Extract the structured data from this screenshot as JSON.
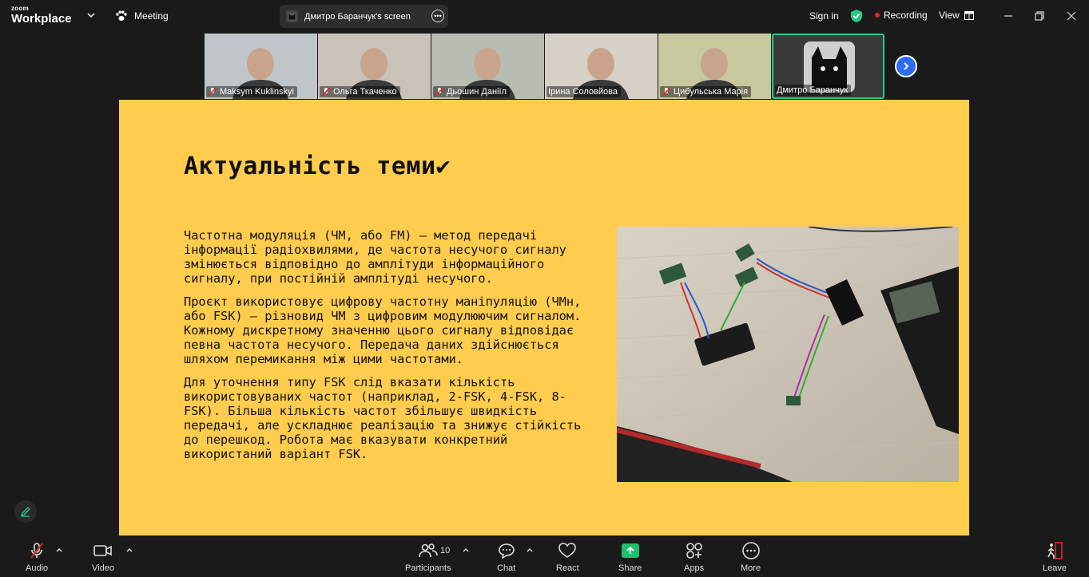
{
  "app": {
    "logo_small": "zoom",
    "logo_big": "Workplace",
    "meeting_label": "Meeting"
  },
  "screen_share": {
    "label": "Дмитро Баранчук's screen"
  },
  "topbar": {
    "sign_in": "Sign in",
    "recording": "Recording",
    "view": "View"
  },
  "participants_strip": [
    {
      "name": "Maksym Kuklinskyi",
      "muted": true,
      "bg": "#bfc5c9"
    },
    {
      "name": "Ольга Ткаченко",
      "muted": true,
      "bg": "#c9c2b9"
    },
    {
      "name": "Дьошин Даніїл",
      "muted": true,
      "bg": "#b7bdb3"
    },
    {
      "name": "Ірина Соловйова",
      "muted": false,
      "bg": "#d6d0c6"
    },
    {
      "name": "Цибульська Марія",
      "muted": true,
      "bg": "#c8c89e"
    },
    {
      "name": "Дмитро Баранчук",
      "muted": false,
      "bg": "#3a3a3a",
      "active": true
    }
  ],
  "slide": {
    "title": "Актуальність теми",
    "title_mark": "✔",
    "paragraphs": [
      "Частотна модуляція (ЧМ, або FM) — метод передачі інформації радіохвилями, де частота несучого сигналу змінюється відповідно до амплітуди інформаційного сигналу, при постійній амплітуді несучого.",
      "Проєкт використовує цифрову частотну маніпуляцію (ЧМн, або FSK) — різновид ЧМ з цифровим модулюючим сигналом. Кожному дискретному значенню цього сигналу відповідає певна частота несучого. Передача даних здійснюється шляхом перемикання між цими частотами.",
      "Для уточнення типу FSK слід вказати кількість використовуваних частот (наприклад, 2-FSK, 4-FSK, 8-FSK). Більша кількість частот збільшує швидкість передачі, але ускладнює реалізацію та знижує стійкість до перешкод. Робота має вказувати конкретний використаний варіант FSK."
    ],
    "background_color": "#ffcc4d"
  },
  "toolbar": {
    "audio": "Audio",
    "video": "Video",
    "participants": "Participants",
    "participants_count": "10",
    "chat": "Chat",
    "react": "React",
    "share": "Share",
    "apps": "Apps",
    "more": "More",
    "leave": "Leave"
  },
  "colors": {
    "accent_green": "#27c98b",
    "share_green": "#1fbf6a",
    "record_red": "#e02828",
    "next_blue": "#2b6cf0"
  }
}
